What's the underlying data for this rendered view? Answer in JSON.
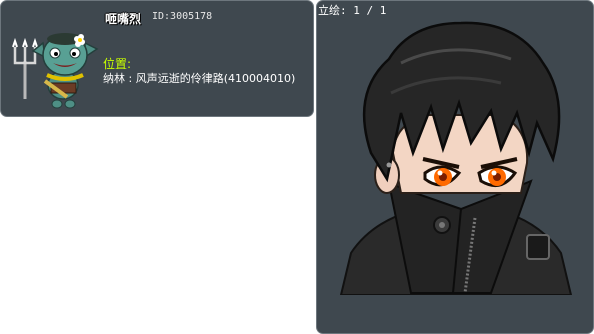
{
  "npc": {
    "name": "咂嘴烈",
    "id_text": "ID:3005178",
    "location_label": "位置:",
    "location_value": "纳林 : 风声远逝的伶律路(410004010)"
  },
  "stand": {
    "label": "立绘: 1 / 1"
  },
  "icons": {
    "npc_sprite": "green-goblin-with-trident-icon",
    "stand_art": "dark-haired-boy-portrait"
  },
  "colors": {
    "panel_bg": "#3f484f",
    "panel_border": "#6d767d",
    "location_label": "#c8ff00",
    "eyes": "#ff6a00"
  }
}
